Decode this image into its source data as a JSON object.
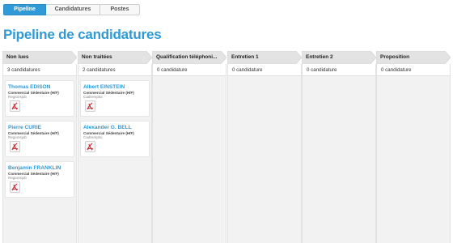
{
  "tabs": [
    {
      "label": "Pipeline"
    },
    {
      "label": "Candidatures"
    },
    {
      "label": "Postes"
    }
  ],
  "page": {
    "title": "Pipeline de candidatures"
  },
  "columns": [
    {
      "title": "Non lues",
      "count": "3 candidatures"
    },
    {
      "title": "Non traitées",
      "count": "2 candidatures"
    },
    {
      "title": "Qualification téléphoni...",
      "count": "0 candidature"
    },
    {
      "title": "Entretien 1",
      "count": "0 candidature"
    },
    {
      "title": "Entretien 2",
      "count": "0 candidature"
    },
    {
      "title": "Proposition",
      "count": "0 candidature"
    }
  ],
  "cards": {
    "col0": [
      {
        "name": "Thomas EDISON",
        "job": "Commercial Sédentaire (H/F)",
        "source": "Regionsjob",
        "icon": "pdf-icon"
      },
      {
        "name": "Pierre CURIE",
        "job": "Commercial Sédentaire (H/F)",
        "source": "Regionsjob",
        "icon": "pdf-icon"
      },
      {
        "name": "Benjamin FRANKLIN",
        "job": "Commercial Sédentaire (H/F)",
        "source": "Regionsjob",
        "icon": "pdf-icon"
      }
    ],
    "col1": [
      {
        "name": "Albert EINSTEIN",
        "job": "Commercial Sédentaire (H/F)",
        "source": "Cadremploi",
        "icon": "pdf-icon"
      },
      {
        "name": "Alexander G. BELL",
        "job": "Commercial Sédentaire (H/F)",
        "source": "Cadremploi",
        "icon": "pdf-icon"
      }
    ]
  },
  "colors": {
    "accent": "#2f9ad6",
    "header_bg": "#e3e3e3",
    "column_bg": "#f2f2f2",
    "pdf_red": "#c8232c"
  }
}
